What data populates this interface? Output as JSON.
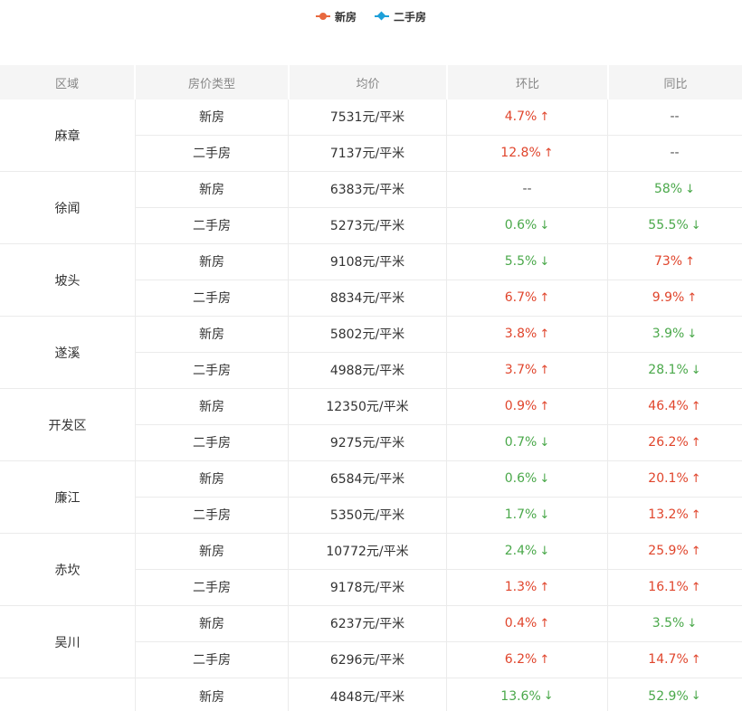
{
  "legend": [
    {
      "label": "新房",
      "color": "#e8693f",
      "marker": "dot"
    },
    {
      "label": "二手房",
      "color": "#1ea0d9",
      "marker": "diamond"
    }
  ],
  "columns": [
    "区域",
    "房价类型",
    "均价",
    "环比",
    "同比"
  ],
  "groups": [
    {
      "region": "麻章",
      "rows": [
        {
          "type": "新房",
          "price": "7531元/平米",
          "mom": "4.7%",
          "mom_dir": "up",
          "yoy": "--",
          "yoy_dir": "none"
        },
        {
          "type": "二手房",
          "price": "7137元/平米",
          "mom": "12.8%",
          "mom_dir": "up",
          "yoy": "--",
          "yoy_dir": "none"
        }
      ]
    },
    {
      "region": "徐闻",
      "rows": [
        {
          "type": "新房",
          "price": "6383元/平米",
          "mom": "--",
          "mom_dir": "none",
          "yoy": "58%",
          "yoy_dir": "down"
        },
        {
          "type": "二手房",
          "price": "5273元/平米",
          "mom": "0.6%",
          "mom_dir": "down",
          "yoy": "55.5%",
          "yoy_dir": "down"
        }
      ]
    },
    {
      "region": "坡头",
      "rows": [
        {
          "type": "新房",
          "price": "9108元/平米",
          "mom": "5.5%",
          "mom_dir": "down",
          "yoy": "73%",
          "yoy_dir": "up"
        },
        {
          "type": "二手房",
          "price": "8834元/平米",
          "mom": "6.7%",
          "mom_dir": "up",
          "yoy": "9.9%",
          "yoy_dir": "up"
        }
      ]
    },
    {
      "region": "遂溪",
      "rows": [
        {
          "type": "新房",
          "price": "5802元/平米",
          "mom": "3.8%",
          "mom_dir": "up",
          "yoy": "3.9%",
          "yoy_dir": "down"
        },
        {
          "type": "二手房",
          "price": "4988元/平米",
          "mom": "3.7%",
          "mom_dir": "up",
          "yoy": "28.1%",
          "yoy_dir": "down"
        }
      ]
    },
    {
      "region": "开发区",
      "rows": [
        {
          "type": "新房",
          "price": "12350元/平米",
          "mom": "0.9%",
          "mom_dir": "up",
          "yoy": "46.4%",
          "yoy_dir": "up"
        },
        {
          "type": "二手房",
          "price": "9275元/平米",
          "mom": "0.7%",
          "mom_dir": "down",
          "yoy": "26.2%",
          "yoy_dir": "up"
        }
      ]
    },
    {
      "region": "廉江",
      "rows": [
        {
          "type": "新房",
          "price": "6584元/平米",
          "mom": "0.6%",
          "mom_dir": "down",
          "yoy": "20.1%",
          "yoy_dir": "up"
        },
        {
          "type": "二手房",
          "price": "5350元/平米",
          "mom": "1.7%",
          "mom_dir": "down",
          "yoy": "13.2%",
          "yoy_dir": "up"
        }
      ]
    },
    {
      "region": "赤坎",
      "rows": [
        {
          "type": "新房",
          "price": "10772元/平米",
          "mom": "2.4%",
          "mom_dir": "down",
          "yoy": "25.9%",
          "yoy_dir": "up"
        },
        {
          "type": "二手房",
          "price": "9178元/平米",
          "mom": "1.3%",
          "mom_dir": "up",
          "yoy": "16.1%",
          "yoy_dir": "up"
        }
      ]
    },
    {
      "region": "吴川",
      "rows": [
        {
          "type": "新房",
          "price": "6237元/平米",
          "mom": "0.4%",
          "mom_dir": "up",
          "yoy": "3.5%",
          "yoy_dir": "down"
        },
        {
          "type": "二手房",
          "price": "6296元/平米",
          "mom": "6.2%",
          "mom_dir": "up",
          "yoy": "14.7%",
          "yoy_dir": "up"
        }
      ]
    },
    {
      "region": "",
      "rows": [
        {
          "type": "新房",
          "price": "4848元/平米",
          "mom": "13.6%",
          "mom_dir": "down",
          "yoy": "52.9%",
          "yoy_dir": "down"
        }
      ]
    }
  ],
  "arrows": {
    "up": "↑",
    "down": "↓"
  },
  "colors": {
    "up": "#e0452c",
    "down": "#4aa84a",
    "header_bg": "#f5f5f5",
    "border": "#ebebeb"
  }
}
